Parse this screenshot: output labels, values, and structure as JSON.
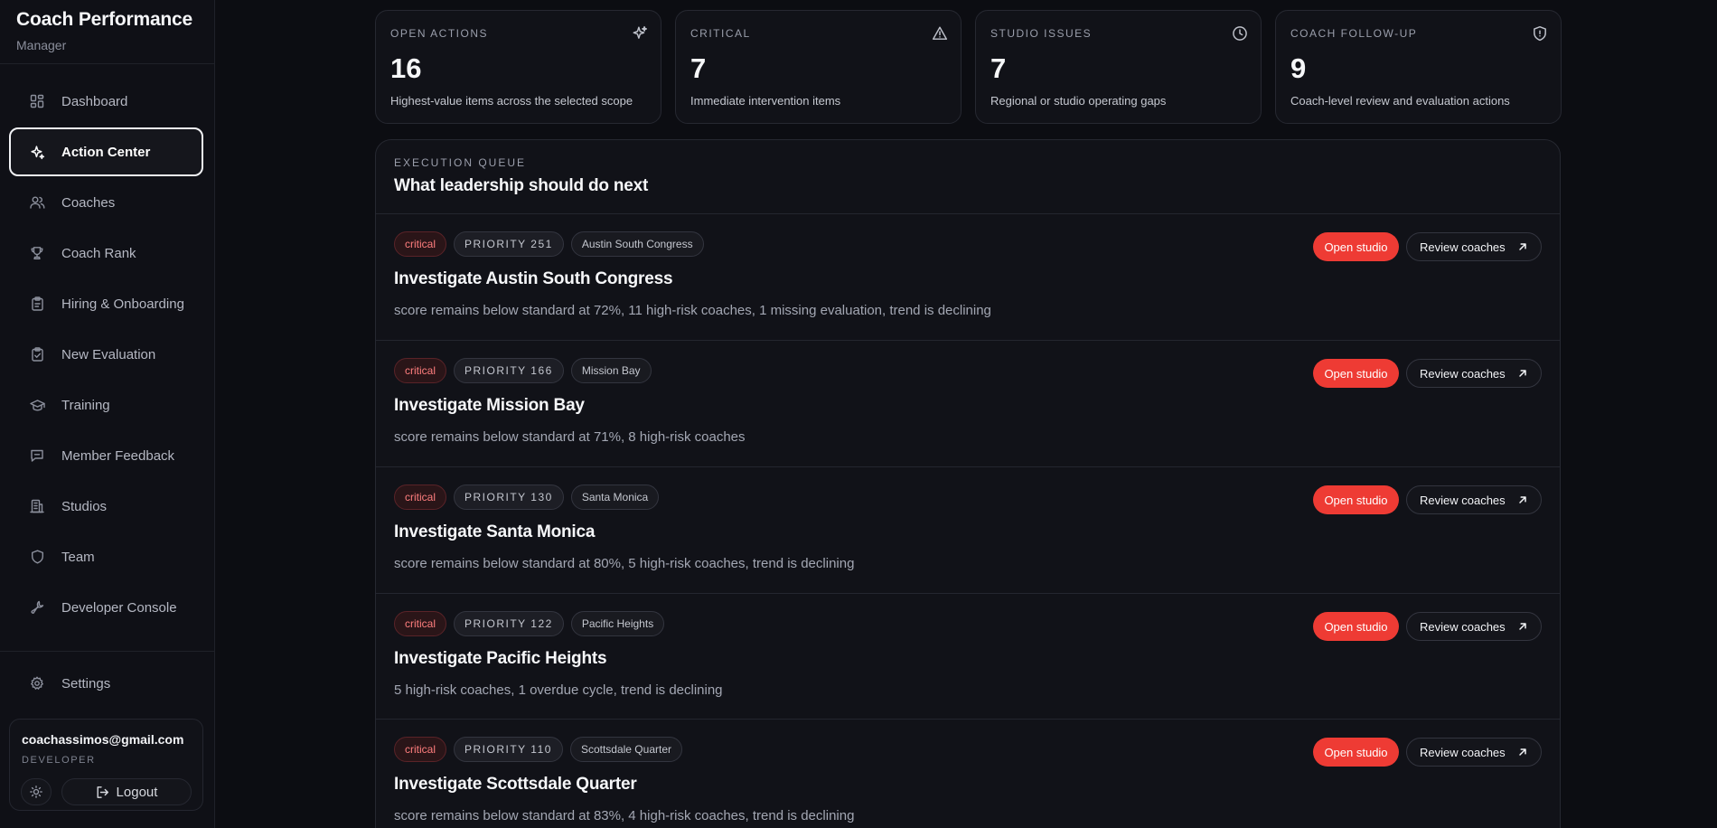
{
  "brand": {
    "title": "Coach Performance",
    "subtitle": "Manager"
  },
  "nav": [
    {
      "label": "Dashboard",
      "icon": "dashboard-icon",
      "active": false
    },
    {
      "label": "Action Center",
      "icon": "sparkles-icon",
      "active": true
    },
    {
      "label": "Coaches",
      "icon": "users-icon",
      "active": false
    },
    {
      "label": "Coach Rank",
      "icon": "trophy-icon",
      "active": false
    },
    {
      "label": "Hiring & Onboarding",
      "icon": "clipboard-icon",
      "active": false
    },
    {
      "label": "New Evaluation",
      "icon": "clipboard-check-icon",
      "active": false
    },
    {
      "label": "Training",
      "icon": "graduation-cap-icon",
      "active": false
    },
    {
      "label": "Member Feedback",
      "icon": "message-icon",
      "active": false
    },
    {
      "label": "Studios",
      "icon": "building-icon",
      "active": false
    },
    {
      "label": "Team",
      "icon": "shield-icon",
      "active": false
    },
    {
      "label": "Developer Console",
      "icon": "wrench-icon",
      "active": false
    }
  ],
  "settings": {
    "label": "Settings",
    "icon": "gear-icon"
  },
  "user": {
    "email": "coachassimos@gmail.com",
    "role": "DEVELOPER",
    "logout_label": "Logout"
  },
  "stats": [
    {
      "label": "OPEN ACTIONS",
      "value": "16",
      "desc": "Highest-value items across the selected scope",
      "icon": "sparkles-icon"
    },
    {
      "label": "CRITICAL",
      "value": "7",
      "desc": "Immediate intervention items",
      "icon": "warning-icon"
    },
    {
      "label": "STUDIO ISSUES",
      "value": "7",
      "desc": "Regional or studio operating gaps",
      "icon": "clock-icon"
    },
    {
      "label": "COACH FOLLOW-UP",
      "value": "9",
      "desc": "Coach-level review and evaluation actions",
      "icon": "shield-icon"
    }
  ],
  "queue": {
    "kicker": "EXECUTION QUEUE",
    "title": "What leadership should do next",
    "open_label": "Open studio",
    "review_label": "Review coaches",
    "items": [
      {
        "severity": "critical",
        "priority": "PRIORITY 251",
        "studio": "Austin South Congress",
        "title": "Investigate Austin South Congress",
        "desc": "score remains below standard at 72%, 11 high-risk coaches, 1 missing evaluation, trend is declining"
      },
      {
        "severity": "critical",
        "priority": "PRIORITY 166",
        "studio": "Mission Bay",
        "title": "Investigate Mission Bay",
        "desc": "score remains below standard at 71%, 8 high-risk coaches"
      },
      {
        "severity": "critical",
        "priority": "PRIORITY 130",
        "studio": "Santa Monica",
        "title": "Investigate Santa Monica",
        "desc": "score remains below standard at 80%, 5 high-risk coaches, trend is declining"
      },
      {
        "severity": "critical",
        "priority": "PRIORITY 122",
        "studio": "Pacific Heights",
        "title": "Investigate Pacific Heights",
        "desc": "5 high-risk coaches, 1 overdue cycle, trend is declining"
      },
      {
        "severity": "critical",
        "priority": "PRIORITY 110",
        "studio": "Scottsdale Quarter",
        "title": "Investigate Scottsdale Quarter",
        "desc": "score remains below standard at 83%, 4 high-risk coaches, trend is declining"
      }
    ]
  }
}
